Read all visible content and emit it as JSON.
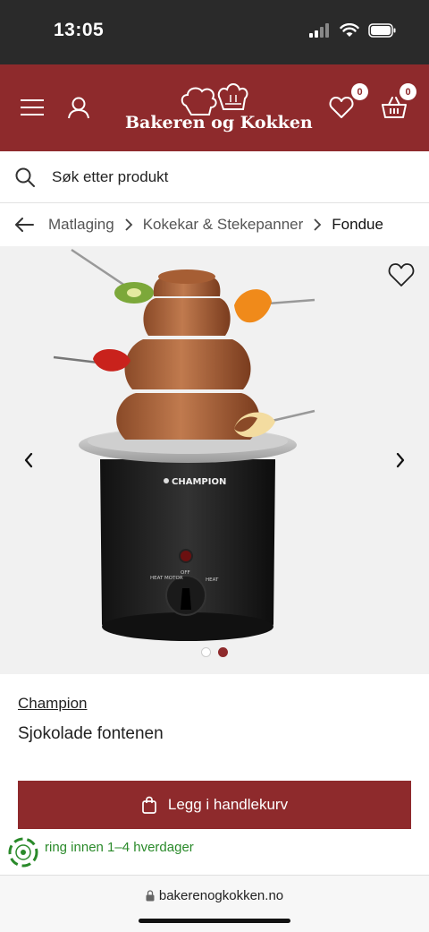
{
  "status_bar": {
    "time": "13:05"
  },
  "header": {
    "logo_text": "Bakeren og Kokken",
    "wishlist_count": "0",
    "cart_count": "0",
    "colors": {
      "brand": "#8e2a2c"
    },
    "icons": [
      "menu-icon",
      "user-icon",
      "heart-icon",
      "basket-icon"
    ]
  },
  "search": {
    "placeholder": "Søk etter produkt"
  },
  "breadcrumb": {
    "items": [
      "Matlaging",
      "Kokekar & Stekepanner",
      "Fondue"
    ]
  },
  "gallery": {
    "slides_total": 2,
    "active_slide": 2,
    "product_brand_on_image": "CHAMPION",
    "knob_labels": {
      "heat_motor": "HEAT MOTOR",
      "off": "OFF",
      "heat": "HEAT"
    }
  },
  "product": {
    "brand": "Champion",
    "name": "Sjokolade fontenen"
  },
  "actions": {
    "add_to_cart": "Legg i handlekurv"
  },
  "delivery": {
    "text": "ring innen 1–4 hverdager",
    "color": "#2a8a2a"
  },
  "browser": {
    "url": "bakerenogkokken.no"
  }
}
